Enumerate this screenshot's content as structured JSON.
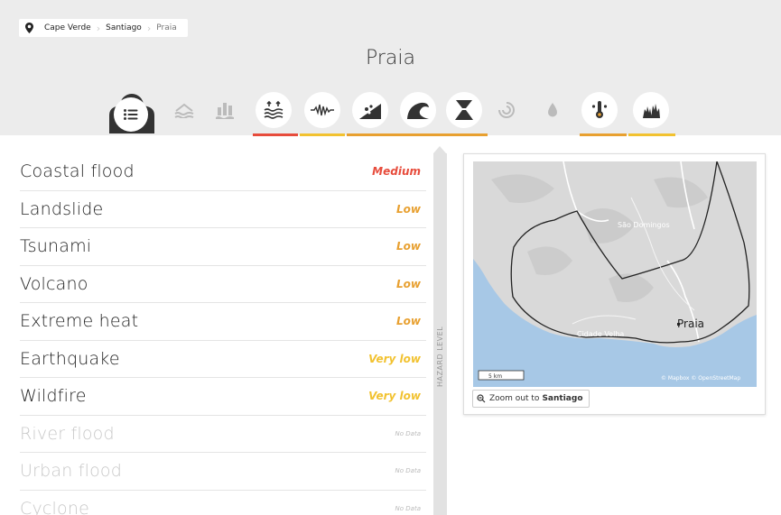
{
  "breadcrumb": {
    "items": [
      "Cape Verde",
      "Santiago",
      "Praia"
    ]
  },
  "page_title": "Praia",
  "hazard_icons": [
    {
      "icon": "list-icon",
      "color": "#333333"
    },
    {
      "icon": "river-flood-icon",
      "color": "#bbbbbb"
    },
    {
      "icon": "urban-flood-icon",
      "color": "#bbbbbb"
    },
    {
      "icon": "coastal-flood-icon",
      "color": "#e74c3c"
    },
    {
      "icon": "earthquake-icon",
      "color": "#f0b040"
    },
    {
      "icon": "landslide-icon",
      "color": "#e8a030"
    },
    {
      "icon": "tsunami-icon",
      "color": "#e8a030"
    },
    {
      "icon": "volcano-icon",
      "color": "#e8a030"
    },
    {
      "icon": "cyclone-icon",
      "color": "#bbbbbb"
    },
    {
      "icon": "water-scarcity-icon",
      "color": "#bbbbbb"
    },
    {
      "icon": "extreme-heat-icon",
      "color": "#e8a030"
    },
    {
      "icon": "wildfire-icon",
      "color": "#f0b040"
    }
  ],
  "hazards": [
    {
      "name": "Coastal flood",
      "level": "Medium",
      "color": "#e74c3c"
    },
    {
      "name": "Landslide",
      "level": "Low",
      "color": "#e8a030"
    },
    {
      "name": "Tsunami",
      "level": "Low",
      "color": "#e8a030"
    },
    {
      "name": "Volcano",
      "level": "Low",
      "color": "#e8a030"
    },
    {
      "name": "Extreme heat",
      "level": "Low",
      "color": "#e8a030"
    },
    {
      "name": "Earthquake",
      "level": "Very low",
      "color": "#f2c230"
    },
    {
      "name": "Wildfire",
      "level": "Very low",
      "color": "#f2c230"
    },
    {
      "name": "River flood",
      "level": "No Data",
      "color": "#bbbbbb"
    },
    {
      "name": "Urban flood",
      "level": "No Data",
      "color": "#bbbbbb"
    },
    {
      "name": "Cyclone",
      "level": "No Data",
      "color": "#bbbbbb"
    }
  ],
  "hazard_level_label": "HAZARD LEVEL",
  "map": {
    "labels": [
      "São Domingos",
      "Cidade Velha",
      "Praia"
    ],
    "scale": "5 km",
    "attribution": "© Mapbox © OpenStreetMap",
    "zoom_prefix": "Zoom out to",
    "zoom_target": "Santiago"
  }
}
